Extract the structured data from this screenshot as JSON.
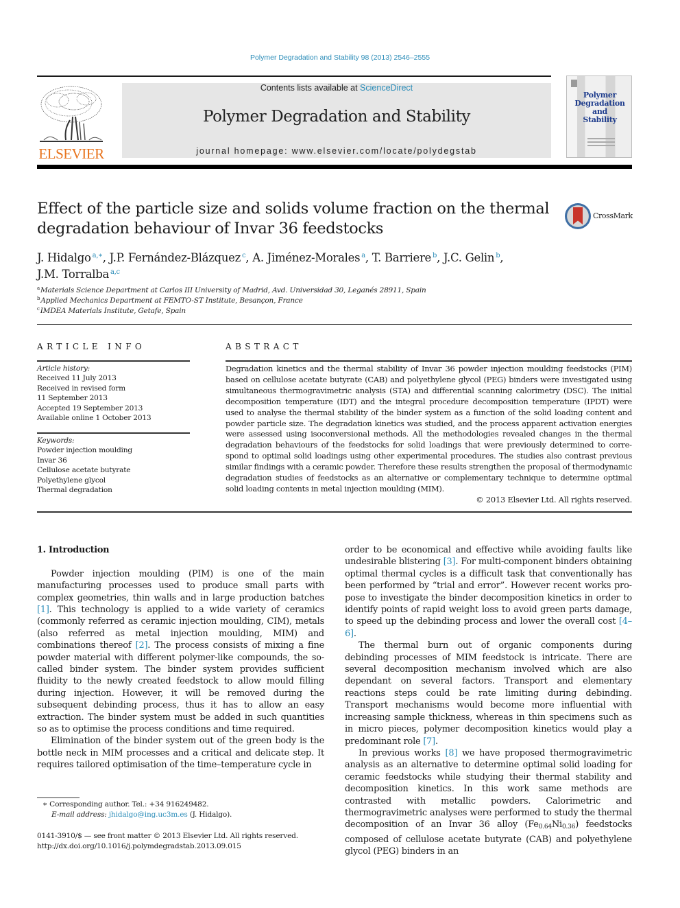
{
  "running_head": "Polymer Degradation and Stability 98 (2013) 2546–2555",
  "masthead": {
    "publisher_logo_text": "ELSEVIER",
    "contents_prefix": "Contents lists available at ",
    "contents_link": "ScienceDirect",
    "journal_title": "Polymer Degradation and Stability",
    "homepage": "journal homepage: www.elsevier.com/locate/polydegstab",
    "cover_title_lines": [
      "Polymer",
      "Degradation",
      "and",
      "Stability"
    ]
  },
  "article": {
    "title": "Effect of the particle size and solids volume fraction on the thermal degradation behaviour of Invar 36 feedstocks",
    "crossmark_label": "CrossMark",
    "authors": [
      {
        "name": "J. Hidalgo",
        "affil": "a,∗",
        "sep": ", "
      },
      {
        "name": "J.P. Fernández-Blázquez",
        "affil": "c",
        "sep": ", "
      },
      {
        "name": "A. Jiménez-Morales",
        "affil": "a",
        "sep": ", "
      },
      {
        "name": "T. Barriere",
        "affil": "b",
        "sep": ", "
      },
      {
        "name": "J.C. Gelin",
        "affil": "b",
        "sep": ","
      },
      {
        "name": "J.M. Torralba",
        "affil": "a,c",
        "sep": ""
      }
    ],
    "affiliations": [
      {
        "key": "a",
        "text": "Materials Science Department at Carlos III University of Madrid, Avd. Universidad 30, Leganés 28911, Spain"
      },
      {
        "key": "b",
        "text": "Applied Mechanics Department at FEMTO-ST Institute, Besançon, France"
      },
      {
        "key": "c",
        "text": "IMDEA Materials Institute, Getafe, Spain"
      }
    ]
  },
  "article_info": {
    "heading": "ARTICLE INFO",
    "history_label": "Article history:",
    "history": [
      "Received 11 July 2013",
      "Received in revised form",
      "11 September 2013",
      "Accepted 19 September 2013",
      "Available online 1 October 2013"
    ],
    "keywords_label": "Keywords:",
    "keywords": [
      "Powder injection moulding",
      "Invar 36",
      "Cellulose acetate butyrate",
      "Polyethylene glycol",
      "Thermal degradation"
    ]
  },
  "abstract": {
    "heading": "ABSTRACT",
    "text": "Degradation kinetics and the thermal stability of Invar 36 powder injection moulding feedstocks (PIM) based on cellulose acetate butyrate (CAB) and polyethylene glycol (PEG) binders were investigated using simultaneous thermogravimetric analysis (STA) and differential scanning calorimetry (DSC). The initial decomposition temperature (IDT) and the integral procedure decomposition temperature (IPDT) were used to analyse the thermal stability of the binder system as a function of the solid loading content and powder particle size. The degradation kinetics was studied, and the process apparent activation energies were assessed using isoconversional methods. All the methodologies revealed changes in the thermal degradation behaviours of the feedstocks for solid loadings that were previously determined to corre­spond to optimal solid loadings using other experimental procedures. The studies also contrast previous similar findings with a ceramic powder. Therefore these results strengthen the proposal of thermody­namic degradation studies of feedstocks as an alternative or complementary technique to determine optimal solid loading contents in metal injection moulding (MIM).",
    "copyright": "© 2013 Elsevier Ltd. All rights reserved."
  },
  "body": {
    "section_heading": "1.  Introduction",
    "left_paragraphs": [
      {
        "parts": [
          {
            "t": "Powder injection moulding (PIM) is one of the main manufacturing processes used to produce small parts with complex geometries, thin walls and in large production batches "
          },
          {
            "ref": "[1]"
          },
          {
            "t": ". This technology is applied to a wide variety of ceramics (commonly referred as ceramic injection moulding, CIM), metals (also referred as metal injection moulding, MIM) and combinations thereof "
          },
          {
            "ref": "[2]"
          },
          {
            "t": ". The process consists of mixing a fine powder material with different polymer-like compounds, the so-called binder system. The binder system provides sufficient fluidity to the newly created feedstock to allow mould filling during injection. However, it will be removed during the subsequent debinding process, thus it has to allow an easy extraction. The binder system must be added in such quantities so as to optimise the process conditions and time required."
          }
        ]
      },
      {
        "parts": [
          {
            "t": "Elimination of the binder system out of the green body is the bottle neck in MIM processes and a critical and delicate step. It requires tailored optimisation of the time–temperature cycle in"
          }
        ]
      }
    ],
    "right_paragraphs": [
      {
        "noindent": true,
        "parts": [
          {
            "t": "order to be economical and effective while avoiding faults like undesirable blistering "
          },
          {
            "ref": "[3]"
          },
          {
            "t": ". For multi-component binders obtaining optimal thermal cycles is a difficult task that conventionally has been performed by “trial and error”. However recent works pro­pose to investigate the binder decomposition kinetics in order to identify points of rapid weight loss to avoid green parts damage, to speed up the debinding process and lower the overall cost "
          },
          {
            "ref": "[4–6]"
          },
          {
            "t": "."
          }
        ]
      },
      {
        "parts": [
          {
            "t": "The thermal burn out of organic components during debinding processes of MIM feedstock is intricate. There are several decom­position mechanism involved which are also dependant on several factors. Transport and elementary reactions steps could be rate limiting during debinding. Transport mechanisms would become more influential with increasing sample thickness, whereas in thin specimens such as in micro pieces, polymer decomposition kinetics would play a predominant role "
          },
          {
            "ref": "[7]"
          },
          {
            "t": "."
          }
        ]
      },
      {
        "parts": [
          {
            "t": "In previous works "
          },
          {
            "ref": "[8]"
          },
          {
            "t": " we have proposed thermogravimetric analysis as an alternative to determine optimal solid loading for ceramic feedstocks while studying their thermal stability and decomposition kinetics. In this work same methods are contrasted with metallic powders. Calorimetric and thermogravimetric ana­lyses were performed to study the thermal decomposition of an Invar 36 alloy (Fe"
          },
          {
            "sub": "0.64"
          },
          {
            "t": "Ni"
          },
          {
            "sub": "0.36"
          },
          {
            "t": ") feedstocks composed of cellulose ace­tate butyrate (CAB) and polyethylene glycol (PEG) binders in an"
          }
        ]
      }
    ]
  },
  "footnotes": {
    "corresponding": "∗  Corresponding author. Tel.: +34 916249482.",
    "email_label": "E-mail address: ",
    "email": "jhidalgo@ing.uc3m.es",
    "email_suffix": " (J. Hidalgo).",
    "front_matter": "0141-3910/$ — see front matter © 2013 Elsevier Ltd. All rights reserved.",
    "doi": "http://dx.doi.org/10.1016/j.polymdegradstab.2013.09.015"
  },
  "colors": {
    "link": "#2a8cb8",
    "elsevier_orange": "#e8731c",
    "band_gray": "#e6e6e6",
    "cover_title": "#1e3c8c",
    "crossmark_red": "#c8352b"
  }
}
